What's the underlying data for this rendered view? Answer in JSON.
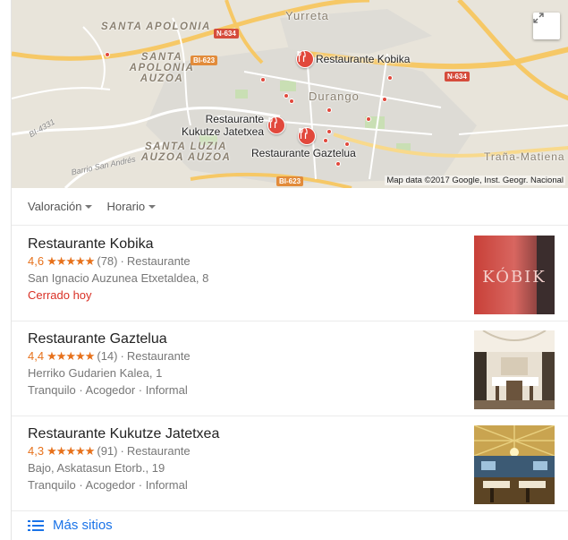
{
  "map": {
    "credit": "Map data ©2017 Google, Inst. Geogr. Nacional",
    "labels": {
      "santa_apolonia": "SANTA APOLONIA",
      "santa_apolonia_auzoa": "SANTA APOLONIA AUZOA",
      "yurreta": "Yurreta",
      "durango": "Durango",
      "santa_luzia": "SANTA LUZIA AUZOA AUZOA",
      "trana": "Traña-Matiena",
      "barrio": "Barrio San Andrés",
      "bi4331": "BI-4331"
    },
    "road_shields": {
      "n634_a": "N-634",
      "n634_b": "N-634",
      "bi623_a": "BI-623",
      "bi623_b": "BI-623"
    },
    "pins": {
      "kobika": "Restaurante Kobika",
      "kukutze": "Restaurante Kukutze Jatetxea",
      "gaztelua": "Restaurante Gaztelua"
    }
  },
  "filters": [
    {
      "label": "Valoración"
    },
    {
      "label": "Horario"
    }
  ],
  "results": [
    {
      "name": "Restaurante Kobika",
      "rating": "4,6",
      "stars": 4.6,
      "reviews": "(78)",
      "category": "Restaurante",
      "address": "San Ignacio Auzunea Etxetaldea, 8",
      "status": "Cerrado hoy",
      "thumb_text": "KÓBIK"
    },
    {
      "name": "Restaurante Gaztelua",
      "rating": "4,4",
      "stars": 4.4,
      "reviews": "(14)",
      "category": "Restaurante",
      "address": "Herriko Gudarien Kalea, 1",
      "tags": "Tranquilo · Acogedor · Informal"
    },
    {
      "name": "Restaurante Kukutze Jatetxea",
      "rating": "4,3",
      "stars": 4.3,
      "reviews": "(91)",
      "category": "Restaurante",
      "address": "Bajo, Askatasun Etorb., 19",
      "tags": "Tranquilo · Acogedor · Informal"
    }
  ],
  "more_label": "Más sitios",
  "colors": {
    "accent": "#1a73e8",
    "star": "#e7711b",
    "closed": "#d93025",
    "pin": "#e1483c"
  }
}
